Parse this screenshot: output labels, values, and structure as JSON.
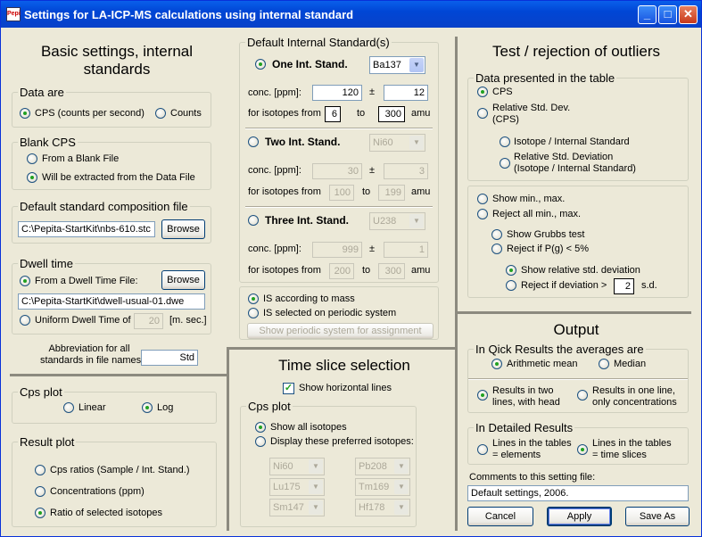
{
  "window": {
    "title": "Settings for LA-ICP-MS calculations using internal standard",
    "icon_label": "Pepi",
    "minimize": "_",
    "maximize": "□",
    "close": "✕"
  },
  "basic": {
    "heading_line1": "Basic settings, internal",
    "heading_line2": "standards",
    "data_are": {
      "legend": "Data are",
      "cps": "CPS (counts per second)",
      "counts": "Counts",
      "selected": "cps"
    },
    "blank": {
      "legend": "Blank CPS",
      "from_file": "From a Blank File",
      "extracted": "Will be extracted from the Data File",
      "selected": "extracted"
    },
    "std_file": {
      "legend": "Default standard composition file",
      "value": "C:\\Pepita-StartKit\\nbs-610.stc",
      "browse": "Browse"
    },
    "dwell": {
      "legend": "Dwell time",
      "from_file": "From a Dwell Time File:",
      "browse": "Browse",
      "file_value": "C:\\Pepita-StartKit\\dwell-usual-01.dwe",
      "uniform": "Uniform Dwell Time of",
      "uniform_value": "20",
      "unit": "[m. sec.]",
      "selected": "file"
    },
    "abbrev": {
      "label_line1": "Abbreviation for all",
      "label_line2": "standards in file names:",
      "value": "Std"
    }
  },
  "int_std": {
    "legend": "Default Internal Standard(s)",
    "one": {
      "label": "One Int. Stand.",
      "element": "Ba137",
      "conc_label": "conc. [ppm]:",
      "conc": "120",
      "pm": "±",
      "err": "12",
      "iso_label": "for isotopes from",
      "from": "6",
      "to_label": "to",
      "to": "300",
      "unit": "amu"
    },
    "two": {
      "label": "Two Int. Stand.",
      "element": "Ni60",
      "conc_label": "conc. [ppm]:",
      "conc": "30",
      "pm": "±",
      "err": "3",
      "iso_label": "for isotopes from",
      "from": "100",
      "to_label": "to",
      "to": "199",
      "unit": "amu"
    },
    "three": {
      "label": "Three Int. Stand.",
      "element": "U238",
      "conc_label": "conc. [ppm]:",
      "conc": "999",
      "pm": "±",
      "err": "1",
      "iso_label": "for isotopes from",
      "from": "200",
      "to_label": "to",
      "to": "300",
      "unit": "amu"
    },
    "selected": "one",
    "is_mass": "IS according to mass",
    "is_periodic": "IS selected on periodic system",
    "is_selected": "mass",
    "show_periodic": "Show periodic system for assignment"
  },
  "outliers": {
    "heading": "Test / rejection of outliers",
    "data_legend": "Data presented in the table",
    "cps": "CPS",
    "rsd_line1": "Relative Std. Dev.",
    "rsd_line2": "(CPS)",
    "iso_is": "Isotope / Internal Standard",
    "rsd_iso_line1": "Relative Std. Deviation",
    "rsd_iso_line2": "(Isotope / Internal Standard)",
    "show_minmax": "Show min., max.",
    "reject_minmax": "Reject all min., max.",
    "grubbs": "Show Grubbs test",
    "reject_pg": "Reject if P(g) < 5%",
    "show_rsd": "Show relative std. deviation",
    "reject_dev": "Reject if deviation >",
    "dev_value": "2",
    "sd_unit": "s.d."
  },
  "output": {
    "heading": "Output",
    "quick_legend": "In Qick Results the averages are",
    "arith": "Arithmetic mean",
    "median": "Median",
    "two_lines_line1": "Results in two",
    "two_lines_line2": "lines, with head",
    "one_line_line1": "Results in one line,",
    "one_line_line2": "only concentrations",
    "detailed_legend": "In Detailed Results",
    "lines_elem_line1": "Lines in the tables",
    "lines_elem_line2": "= elements",
    "lines_time_line1": "Lines in the tables",
    "lines_time_line2": "= time slices",
    "comments_label": "Comments to this setting file:",
    "comments_value": "Default settings, 2006.",
    "cancel": "Cancel",
    "apply": "Apply",
    "save_as": "Save As"
  },
  "cps_plot": {
    "legend": "Cps plot",
    "linear": "Linear",
    "log": "Log"
  },
  "result_plot": {
    "legend": "Result plot",
    "ratios": "Cps ratios (Sample / Int. Stand.)",
    "conc": "Concentrations (ppm)",
    "selected": "Ratio of selected isotopes"
  },
  "time_slice": {
    "heading": "Time slice selection",
    "show_lines": "Show horizontal lines",
    "cps_legend": "Cps plot",
    "show_all": "Show all isotopes",
    "display_pref": "Display these preferred isotopes:",
    "isotopes": [
      "Ni60",
      "Pb208",
      "Lu175",
      "Tm169",
      "Sm147",
      "Hf178"
    ]
  }
}
